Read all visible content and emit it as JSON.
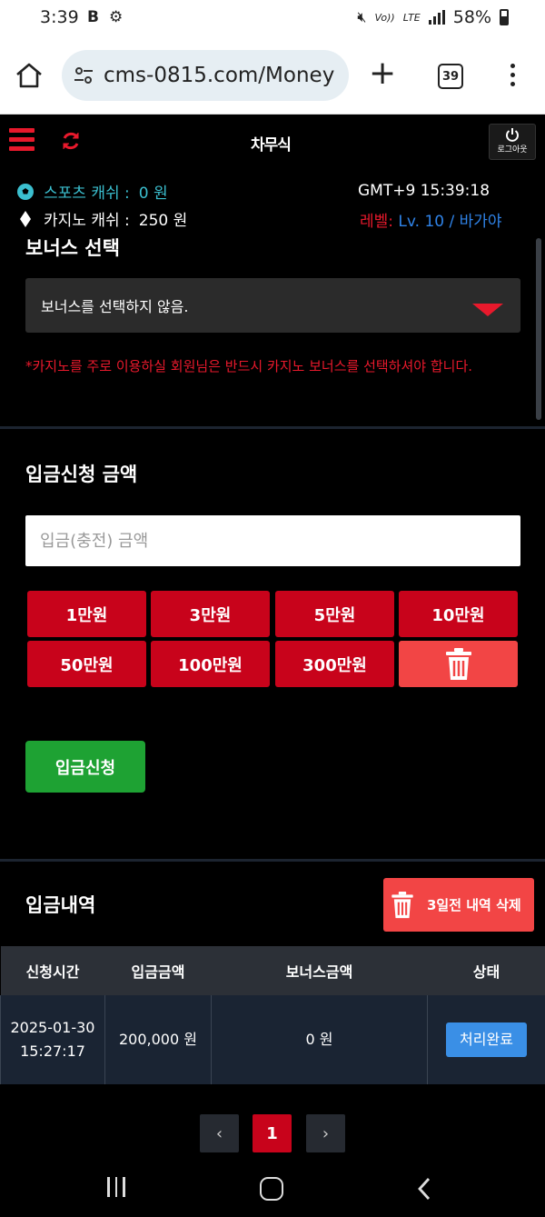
{
  "status_bar": {
    "time": "3:39",
    "app_icon_b": "B",
    "network_label": "Vo))",
    "lte_label": "LTE",
    "battery": "58%"
  },
  "browser": {
    "url": "cms-0815.com/Money",
    "tab_count": "39"
  },
  "header": {
    "logo": "차무식",
    "logout_label": "로그아웃"
  },
  "info": {
    "sports_cash_label": "스포츠 캐쉬 :",
    "sports_cash_value": "0 원",
    "casino_cash_label": "카지노 캐쉬 :",
    "casino_cash_value": "250 원",
    "clock": "GMT+9 15:39:18",
    "level_label": "레벨:",
    "level_value": "Lv. 10 / 바가야"
  },
  "bonus": {
    "title": "보너스 선택",
    "selected": "보너스를 선택하지 않음.",
    "warning": "*카지노를 주로 이용하실 회원님은 반드시 카지노 보너스를 선택하셔야 합니다."
  },
  "deposit": {
    "title": "입금신청 금액",
    "placeholder": "입금(충전) 금액",
    "amounts": [
      "1만원",
      "3만원",
      "5만원",
      "10만원",
      "50만원",
      "100만원",
      "300만원"
    ],
    "submit_label": "입금신청"
  },
  "history": {
    "title": "입금내역",
    "delete_label": "3일전 내역 삭제",
    "columns": [
      "신청시간",
      "입금금액",
      "보너스금액",
      "상태"
    ],
    "rows": [
      {
        "date": "2025-01-30",
        "time": "15:27:17",
        "amount": "200,000 원",
        "bonus": "0 원",
        "status": "처리완료"
      }
    ]
  },
  "pagination": {
    "prev": "‹",
    "current": "1",
    "next": "›"
  },
  "colors": {
    "accent_red": "#c8031b",
    "submit_green": "#1ea233",
    "status_blue": "#3a8fe6",
    "sports_cyan": "#3bbfcf"
  }
}
